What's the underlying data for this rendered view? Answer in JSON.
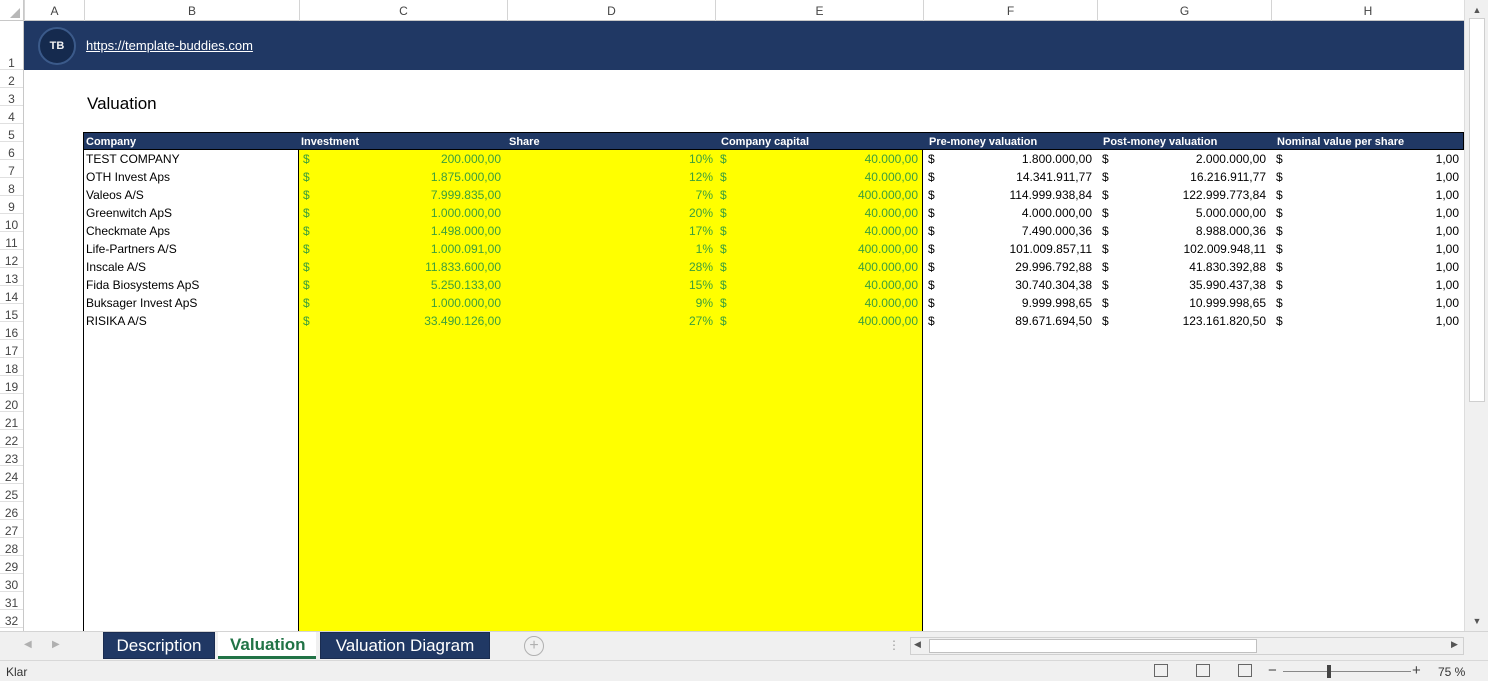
{
  "columns": [
    "A",
    "B",
    "C",
    "D",
    "E",
    "F",
    "G",
    "H"
  ],
  "rows": [
    "1",
    "2",
    "3",
    "4",
    "5",
    "6",
    "7",
    "8",
    "9",
    "10",
    "11",
    "12",
    "13",
    "14",
    "15",
    "16",
    "17",
    "18",
    "19",
    "20",
    "21",
    "22",
    "23",
    "24",
    "25",
    "26",
    "27",
    "28",
    "29",
    "30",
    "31",
    "32"
  ],
  "banner": {
    "logo_text": "TB",
    "link": "https://template-buddies.com"
  },
  "sheet_title": "Valuation",
  "table": {
    "headers": [
      "Company",
      "Investment",
      "Share",
      "Company capital",
      "Pre-money valuation",
      "Post-money valuation",
      "Nominal value per share"
    ],
    "currency": "$",
    "rows": [
      [
        "TEST COMPANY",
        "200.000,00",
        "10%",
        "40.000,00",
        "1.800.000,00",
        "2.000.000,00",
        "1,00"
      ],
      [
        "OTH Invest Aps",
        "1.875.000,00",
        "12%",
        "40.000,00",
        "14.341.911,77",
        "16.216.911,77",
        "1,00"
      ],
      [
        "Valeos A/S",
        "7.999.835,00",
        "7%",
        "400.000,00",
        "114.999.938,84",
        "122.999.773,84",
        "1,00"
      ],
      [
        "Greenwitch ApS",
        "1.000.000,00",
        "20%",
        "40.000,00",
        "4.000.000,00",
        "5.000.000,00",
        "1,00"
      ],
      [
        "Checkmate Aps",
        "1.498.000,00",
        "17%",
        "40.000,00",
        "7.490.000,36",
        "8.988.000,36",
        "1,00"
      ],
      [
        "Life-Partners A/S",
        "1.000.091,00",
        "1%",
        "400.000,00",
        "101.009.857,11",
        "102.009.948,11",
        "1,00"
      ],
      [
        "Inscale A/S",
        "11.833.600,00",
        "28%",
        "400.000,00",
        "29.996.792,88",
        "41.830.392,88",
        "1,00"
      ],
      [
        "Fida Biosystems ApS",
        "5.250.133,00",
        "15%",
        "40.000,00",
        "30.740.304,38",
        "35.990.437,38",
        "1,00"
      ],
      [
        "Buksager Invest ApS",
        "1.000.000,00",
        "9%",
        "40.000,00",
        "9.999.998,65",
        "10.999.998,65",
        "1,00"
      ],
      [
        "RISIKA A/S",
        "33.490.126,00",
        "27%",
        "400.000,00",
        "89.671.694,50",
        "123.161.820,50",
        "1,00"
      ]
    ]
  },
  "tabs": [
    {
      "label": "Description",
      "active": false
    },
    {
      "label": "Valuation",
      "active": true
    },
    {
      "label": "Valuation Diagram",
      "active": false
    }
  ],
  "status": {
    "text": "Klar",
    "zoom": "75 %"
  },
  "colors": {
    "header_navy": "#203864",
    "input_yellow": "#ffff00",
    "input_text_green": "#3c9f3c",
    "excel_green": "#217346"
  }
}
